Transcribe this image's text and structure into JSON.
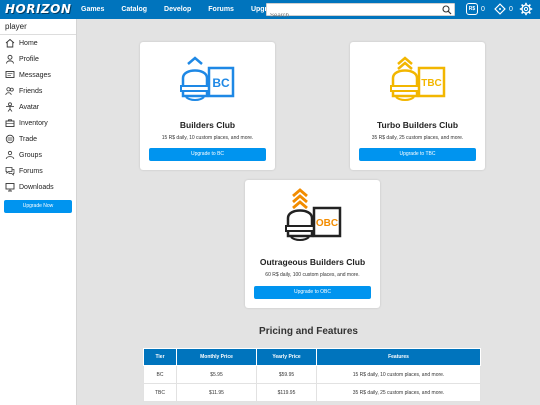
{
  "header": {
    "logo": "HORIZON",
    "nav": [
      "Games",
      "Catalog",
      "Develop",
      "Forums",
      "Upgrade"
    ],
    "search_placeholder": "Search",
    "robux_icon_text": "R$",
    "robux_count": "0",
    "tix_count": "0"
  },
  "sidebar": {
    "username": "player",
    "items": [
      {
        "label": "Home",
        "icon": "home-icon"
      },
      {
        "label": "Profile",
        "icon": "profile-icon"
      },
      {
        "label": "Messages",
        "icon": "messages-icon"
      },
      {
        "label": "Friends",
        "icon": "friends-icon"
      },
      {
        "label": "Avatar",
        "icon": "avatar-icon"
      },
      {
        "label": "Inventory",
        "icon": "inventory-icon"
      },
      {
        "label": "Trade",
        "icon": "trade-icon"
      },
      {
        "label": "Groups",
        "icon": "groups-icon"
      },
      {
        "label": "Forums",
        "icon": "forums-icon"
      },
      {
        "label": "Downloads",
        "icon": "downloads-icon"
      }
    ],
    "upgrade_button": "Upgrade Now"
  },
  "cards": {
    "bc": {
      "badge_text": "BC",
      "title": "Builders Club",
      "desc": "15 R$ daily, 10 custom places, and more.",
      "button": "Upgrade to BC",
      "color": "#1e88e5"
    },
    "tbc": {
      "badge_text": "TBC",
      "title": "Turbo Builders Club",
      "desc": "35 R$ daily, 25 custom places, and more.",
      "button": "Upgrade to TBC",
      "color": "#f2b600"
    },
    "obc": {
      "badge_text": "OBC",
      "title": "Outrageous Builders Club",
      "desc": "60 R$ daily, 100 custom places, and more.",
      "button": "Upgrade to OBC",
      "color": "#222222",
      "accent": "#f28c00"
    }
  },
  "pricing": {
    "title": "Pricing and Features",
    "headers": [
      "Tier",
      "Monthly Price",
      "Yearly Price",
      "Features"
    ],
    "rows": [
      [
        "BC",
        "$5.95",
        "$59.95",
        "15 R$ daily, 10 custom places, and more."
      ],
      [
        "TBC",
        "$11.95",
        "$119.95",
        "35 R$ daily, 25 custom places, and more."
      ]
    ]
  }
}
